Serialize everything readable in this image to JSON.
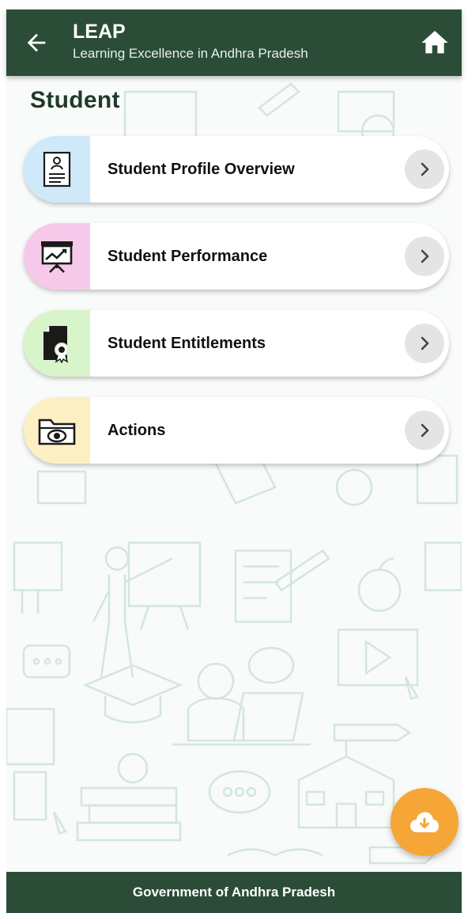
{
  "header": {
    "title": "LEAP",
    "subtitle": "Learning Excellence in Andhra Pradesh",
    "back_icon": "arrow-left-icon",
    "home_icon": "home-icon"
  },
  "page": {
    "title": "Student"
  },
  "menu": {
    "items": [
      {
        "label": "Student Profile Overview",
        "icon": "profile-document-icon",
        "accent": "#cfe9f8"
      },
      {
        "label": "Student Performance",
        "icon": "presentation-chart-icon",
        "accent": "#f6c9ea"
      },
      {
        "label": "Student Entitlements",
        "icon": "certificate-document-icon",
        "accent": "#d8f5c9"
      },
      {
        "label": "Actions",
        "icon": "folder-icon",
        "accent": "#fcefc3"
      }
    ],
    "chevron_icon": "chevron-right-icon"
  },
  "fab": {
    "icon": "cloud-download-icon",
    "color": "#f5a636"
  },
  "footer": {
    "text": "Government of Andhra Pradesh"
  },
  "colors": {
    "primary": "#2b4d37",
    "title": "#1f3a2a"
  }
}
